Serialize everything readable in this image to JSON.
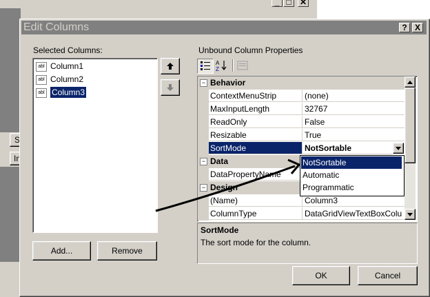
{
  "background_window": {
    "left_tab_s": "S",
    "left_tab_in": "In"
  },
  "dialog": {
    "title": "Edit Columns",
    "help_button": "?",
    "close_button": "X"
  },
  "selected_columns": {
    "label": "Selected Columns:",
    "items": [
      {
        "icon_text": "abl",
        "label": "Column1"
      },
      {
        "icon_text": "abl",
        "label": "Column2"
      },
      {
        "icon_text": "abl",
        "label": "Column3"
      }
    ],
    "selected_index": 2,
    "add_button": "Add...",
    "remove_button": "Remove"
  },
  "properties": {
    "label": "Unbound Column Properties",
    "categories": [
      {
        "name": "Behavior",
        "toggle": "−"
      },
      {
        "name": "Data",
        "toggle": "−"
      },
      {
        "name": "Design",
        "toggle": "−"
      }
    ],
    "behavior_rows": [
      {
        "name": "ContextMenuStrip",
        "value": "(none)"
      },
      {
        "name": "MaxInputLength",
        "value": "32767"
      },
      {
        "name": "ReadOnly",
        "value": "False"
      },
      {
        "name": "Resizable",
        "value": "True"
      },
      {
        "name": "SortMode",
        "value": "NotSortable"
      }
    ],
    "data_rows": [
      {
        "name": "DataPropertyName",
        "value": ""
      }
    ],
    "design_rows": [
      {
        "name": "(Name)",
        "value": "Column3"
      },
      {
        "name": "ColumnType",
        "value": "DataGridViewTextBoxColu"
      }
    ],
    "dropdown_options": [
      "NotSortable",
      "Automatic",
      "Programmatic"
    ],
    "dropdown_selected": "NotSortable",
    "description_title": "SortMode",
    "description_text": "The sort mode for the column."
  },
  "footer": {
    "ok": "OK",
    "cancel": "Cancel"
  },
  "colors": {
    "titlebar": "#808080",
    "selection": "#0a246a",
    "face": "#d4d0c8"
  }
}
